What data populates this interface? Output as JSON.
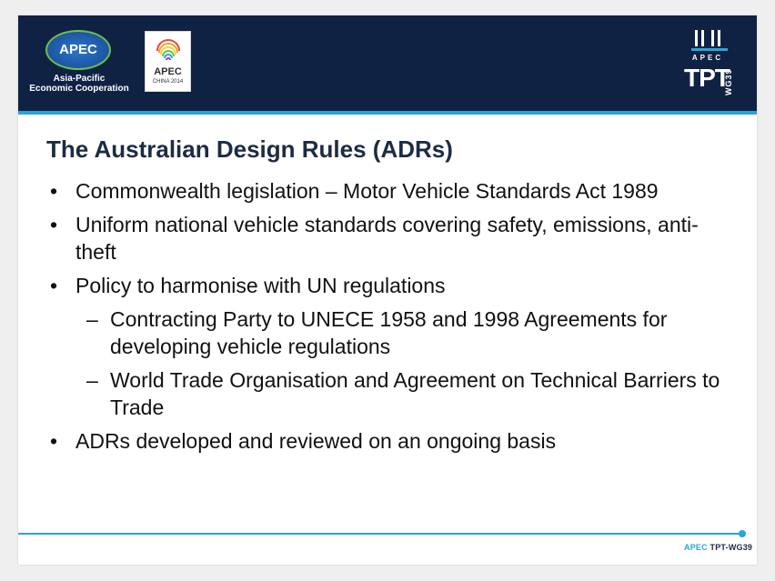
{
  "header": {
    "apec_logo": {
      "name": "APEC",
      "subtitle_line1": "Asia-Pacific",
      "subtitle_line2": "Economic Cooperation",
      "ring_color": "#6cc04a",
      "globe_color": "#1f5aa8"
    },
    "china_logo": {
      "name": "APEC",
      "year_text": "CHINA 2014"
    },
    "tpt_logo": {
      "apec_text": "APEC",
      "tpt_text": "TPT",
      "wg_text": "WG39"
    },
    "background_color": "#102244",
    "accent_color": "#2aa4d8"
  },
  "slide": {
    "title": "The Australian Design Rules (ADRs)",
    "bullets": [
      {
        "marker": "•",
        "text": "Commonwealth legislation – Motor Vehicle Standards Act 1989"
      },
      {
        "marker": "•",
        "text": "Uniform national vehicle standards covering safety, emissions, anti-theft"
      },
      {
        "marker": "•",
        "text": "Policy to harmonise with UN regulations"
      }
    ],
    "sub_bullets": [
      {
        "marker": "–",
        "text": "Contracting Party to UNECE 1958 and 1998 Agreements for developing vehicle regulations"
      },
      {
        "marker": "–",
        "text": "World Trade Organisation and Agreement on Technical Barriers to Trade"
      }
    ],
    "last_bullet": {
      "marker": "•",
      "text": "ADRs developed and reviewed on an ongoing basis"
    }
  },
  "footer": {
    "apec": "APEC",
    "tpt": "TPT-WG39"
  }
}
